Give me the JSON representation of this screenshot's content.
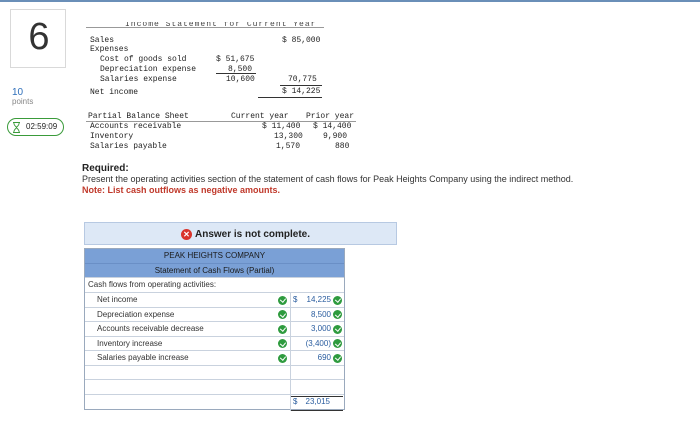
{
  "question": {
    "number": "6",
    "points_value": "10",
    "points_label": "points",
    "timer": "02:59:09"
  },
  "income_statement": {
    "heading": "Income Statement for Current Year",
    "rows": [
      {
        "label": "Sales",
        "indent": 0,
        "col1": "",
        "col2": "$ 85,000"
      },
      {
        "label": "Expenses",
        "indent": 0,
        "col1": "",
        "col2": ""
      },
      {
        "label": "Cost of goods sold",
        "indent": 1,
        "col1": "$ 51,675",
        "col2": ""
      },
      {
        "label": "Depreciation expense",
        "indent": 1,
        "col1": "8,500",
        "col2": ""
      },
      {
        "label": "Salaries expense",
        "indent": 1,
        "col1": "10,600",
        "col2": "70,775"
      },
      {
        "label": "Net income",
        "indent": 0,
        "col1": "",
        "col2": "$ 14,225"
      }
    ]
  },
  "balance_sheet": {
    "title": "Partial Balance Sheet",
    "col_current": "Current year",
    "col_prior": "Prior year",
    "rows": [
      {
        "label": "Accounts receivable",
        "current": "$ 11,400",
        "prior": "$ 14,400"
      },
      {
        "label": "Inventory",
        "current": "13,300",
        "prior": "9,900"
      },
      {
        "label": "Salaries payable",
        "current": "1,570",
        "prior": "880"
      }
    ]
  },
  "required": {
    "heading": "Required:",
    "instruction": "Present the operating activities section of the statement of cash flows for Peak Heights Company using the indirect method.",
    "note": "Note: List cash outflows as negative amounts."
  },
  "banner": {
    "icon": "x-circle-icon",
    "text": "Answer is not complete."
  },
  "answer": {
    "company": "PEAK HEIGHTS COMPANY",
    "statement_title": "Statement of Cash Flows (Partial)",
    "section_label": "Cash flows from operating activities:",
    "rows": [
      {
        "label": "Net income",
        "dollar": "$",
        "value": "14,225",
        "correct": true
      },
      {
        "label": "Depreciation expense",
        "dollar": "",
        "value": "8,500",
        "correct": true
      },
      {
        "label": "Accounts receivable decrease",
        "dollar": "",
        "value": "3,000",
        "correct": true
      },
      {
        "label": "Inventory increase",
        "dollar": "",
        "value": "(3,400)",
        "correct": true
      },
      {
        "label": "Salaries payable increase",
        "dollar": "",
        "value": "690",
        "correct": true
      },
      {
        "label": "",
        "dollar": "",
        "value": "",
        "correct": false
      },
      {
        "label": "",
        "dollar": "",
        "value": "",
        "correct": false
      }
    ],
    "total_dollar": "$",
    "total_value": "23,015"
  },
  "colors": {
    "header_blue": "#7aa0d6",
    "banner_blue": "#dde8f6",
    "check_green": "#2e9b3e",
    "error_red": "#d9342b",
    "value_blue": "#2a5d9f"
  }
}
